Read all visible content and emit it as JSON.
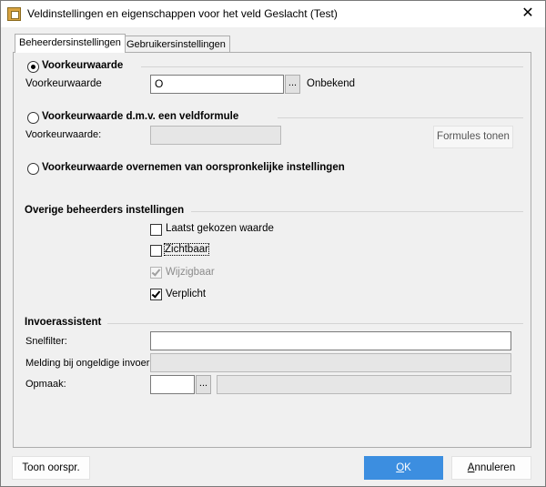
{
  "window": {
    "title": "Veldinstellingen en eigenschappen voor het veld Geslacht (Test)",
    "close_glyph": "✕"
  },
  "tabs": [
    {
      "label": "Beheerdersinstellingen",
      "active": true
    },
    {
      "label": "Gebruikersinstellingen",
      "active": false
    }
  ],
  "default_value": {
    "option_label": "Voorkeurwaarde",
    "field_label": "Voorkeurwaarde",
    "value": "O",
    "browse_label": "...",
    "resolved_text": "Onbekend"
  },
  "formula": {
    "option_label": "Voorkeurwaarde d.m.v. een veldformule",
    "field_label": "Voorkeurwaarde:",
    "value": "",
    "show_formulas_button": "Formules tonen"
  },
  "inherit": {
    "option_label": "Voorkeurwaarde overnemen van oorspronkelijke instellingen"
  },
  "other_settings": {
    "heading": "Overige beheerders instellingen",
    "checkboxes": [
      {
        "label": "Laatst gekozen waarde",
        "checked": false,
        "enabled": true
      },
      {
        "label": "Zichtbaar",
        "checked": false,
        "enabled": true
      },
      {
        "label": "Wijzigbaar",
        "checked": true,
        "enabled": false
      },
      {
        "label": "Verplicht",
        "checked": true,
        "enabled": true
      }
    ]
  },
  "input_assistant": {
    "heading": "Invoerassistent",
    "quickfilter_label": "Snelfilter:",
    "quickfilter_value": "",
    "invalid_message_label": "Melding bij ongeldige invoer:",
    "invalid_message_value": "",
    "format_label": "Opmaak:",
    "format_value": "",
    "format_browse_label": "..."
  },
  "footer": {
    "reset_button": "Toon oorspr.",
    "ok_button": "OK",
    "cancel_button": "Annuleren"
  },
  "colors": {
    "ok_button_bg": "#3c8ee0",
    "panel_bg": "#f0f0f0",
    "disabled_field_bg": "#e6e6e6"
  }
}
